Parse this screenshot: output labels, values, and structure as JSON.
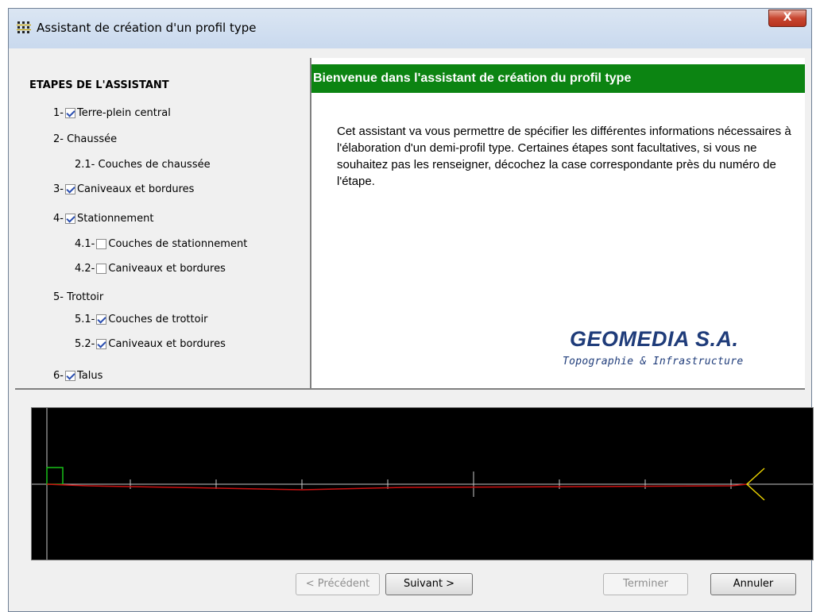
{
  "window": {
    "title": "Assistant de création d'un profil type",
    "close_label": "X"
  },
  "steps": {
    "title": "ETAPES DE L'ASSISTANT",
    "items": [
      {
        "number": "1-",
        "label": "Terre-plein central",
        "checkbox": true,
        "checked": true
      },
      {
        "number": "2-",
        "label": "Chaussée",
        "checkbox": false
      },
      {
        "number": "2.1-",
        "label": "Couches de chaussée",
        "checkbox": false
      },
      {
        "number": "3-",
        "label": "Caniveaux et bordures",
        "checkbox": true,
        "checked": true
      },
      {
        "number": "4-",
        "label": "Stationnement",
        "checkbox": true,
        "checked": true
      },
      {
        "number": "4.1-",
        "label": "Couches de stationnement",
        "checkbox": true,
        "checked": false
      },
      {
        "number": "4.2-",
        "label": "Caniveaux et bordures",
        "checkbox": true,
        "checked": false
      },
      {
        "number": "5-",
        "label": "Trottoir",
        "checkbox": false
      },
      {
        "number": "5.1-",
        "label": "Couches de trottoir",
        "checkbox": true,
        "checked": true
      },
      {
        "number": "5.2-",
        "label": "Caniveaux et bordures",
        "checkbox": true,
        "checked": true
      },
      {
        "number": "6-",
        "label": "Talus",
        "checkbox": true,
        "checked": true
      }
    ]
  },
  "welcome": {
    "header": "Bienvenue dans l'assistant de création du profil type",
    "text": "Cet assistant va vous permettre de spécifier les différentes informations nécessaires à l'élaboration d'un demi-profil type. Certaines étapes sont facultatives, si vous ne souhaitez pas les renseigner, décochez la case correspondante près du numéro de l'étape.",
    "logo_main": "GEOMEDIA S.A.",
    "logo_sub": "Topographie & Infrastructure"
  },
  "buttons": {
    "previous": "< Précédent",
    "next": "Suivant >",
    "finish": "Terminer",
    "cancel": "Annuler"
  },
  "colors": {
    "header_green": "#0c8412",
    "logo_blue": "#1f3c7a",
    "profile_line": "#cc1010",
    "axis": "#c8c8c8",
    "talus": "#e8d000",
    "tpc_marker": "#18c018"
  }
}
